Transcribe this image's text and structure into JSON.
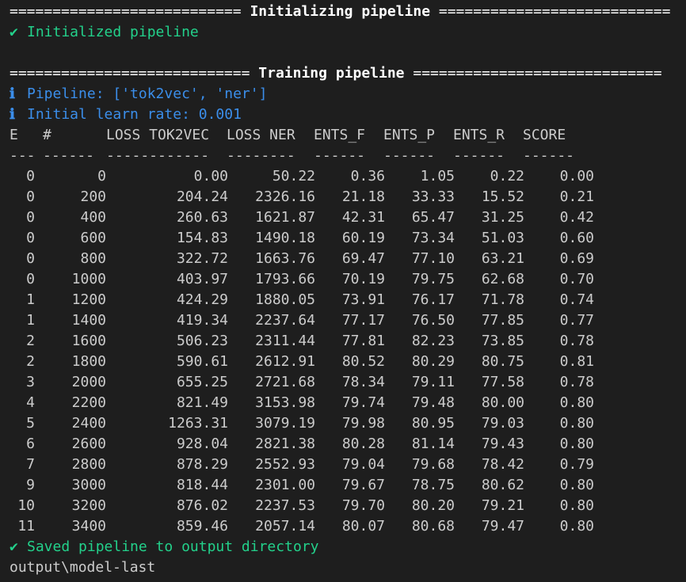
{
  "terminal": {
    "init_header": {
      "left": "===========================",
      "title": "Initializing pipeline",
      "right": "==========================="
    },
    "init_done": {
      "icon": "✔",
      "text": "Initialized pipeline"
    },
    "train_header": {
      "left": "============================",
      "title": "Training pipeline",
      "right": "============================="
    },
    "info_lines": [
      {
        "icon": "ℹ",
        "text": "Pipeline: ['tok2vec', 'ner']"
      },
      {
        "icon": "ℹ",
        "text": "Initial learn rate: 0.001"
      }
    ],
    "table": {
      "headers": [
        "E",
        "#",
        "LOSS TOK2VEC",
        "LOSS NER",
        "ENTS_F",
        "ENTS_P",
        "ENTS_R",
        "SCORE"
      ],
      "dashes": [
        "---",
        "------",
        "------------",
        "--------",
        "------",
        "------",
        "------",
        "------"
      ],
      "rows": [
        [
          "0",
          "0",
          "0.00",
          "50.22",
          "0.36",
          "1.05",
          "0.22",
          "0.00"
        ],
        [
          "0",
          "200",
          "204.24",
          "2326.16",
          "21.18",
          "33.33",
          "15.52",
          "0.21"
        ],
        [
          "0",
          "400",
          "260.63",
          "1621.87",
          "42.31",
          "65.47",
          "31.25",
          "0.42"
        ],
        [
          "0",
          "600",
          "154.83",
          "1490.18",
          "60.19",
          "73.34",
          "51.03",
          "0.60"
        ],
        [
          "0",
          "800",
          "322.72",
          "1663.76",
          "69.47",
          "77.10",
          "63.21",
          "0.69"
        ],
        [
          "0",
          "1000",
          "403.97",
          "1793.66",
          "70.19",
          "79.75",
          "62.68",
          "0.70"
        ],
        [
          "1",
          "1200",
          "424.29",
          "1880.05",
          "73.91",
          "76.17",
          "71.78",
          "0.74"
        ],
        [
          "1",
          "1400",
          "419.34",
          "2237.64",
          "77.17",
          "76.50",
          "77.85",
          "0.77"
        ],
        [
          "2",
          "1600",
          "506.23",
          "2311.44",
          "77.81",
          "82.23",
          "73.85",
          "0.78"
        ],
        [
          "2",
          "1800",
          "590.61",
          "2612.91",
          "80.52",
          "80.29",
          "80.75",
          "0.81"
        ],
        [
          "3",
          "2000",
          "655.25",
          "2721.68",
          "78.34",
          "79.11",
          "77.58",
          "0.78"
        ],
        [
          "4",
          "2200",
          "821.49",
          "3153.98",
          "79.74",
          "79.48",
          "80.00",
          "0.80"
        ],
        [
          "5",
          "2400",
          "1263.31",
          "3079.19",
          "79.98",
          "80.95",
          "79.03",
          "0.80"
        ],
        [
          "6",
          "2600",
          "928.04",
          "2821.38",
          "80.28",
          "81.14",
          "79.43",
          "0.80"
        ],
        [
          "7",
          "2800",
          "878.29",
          "2552.93",
          "79.04",
          "79.68",
          "78.42",
          "0.79"
        ],
        [
          "9",
          "3000",
          "818.44",
          "2301.00",
          "79.67",
          "78.75",
          "80.62",
          "0.80"
        ],
        [
          "10",
          "3200",
          "876.02",
          "2237.53",
          "79.70",
          "80.20",
          "79.21",
          "0.80"
        ],
        [
          "11",
          "3400",
          "859.46",
          "2057.14",
          "80.07",
          "80.68",
          "79.47",
          "0.80"
        ]
      ]
    },
    "saved": {
      "icon": "✔",
      "text": "Saved pipeline to output directory"
    },
    "output_path": "output\\model-last",
    "colors": {
      "background": "#1e1e1e",
      "text": "#cccccc",
      "success": "#23d18b",
      "info": "#3b8eea",
      "header": "#ffffff"
    }
  }
}
